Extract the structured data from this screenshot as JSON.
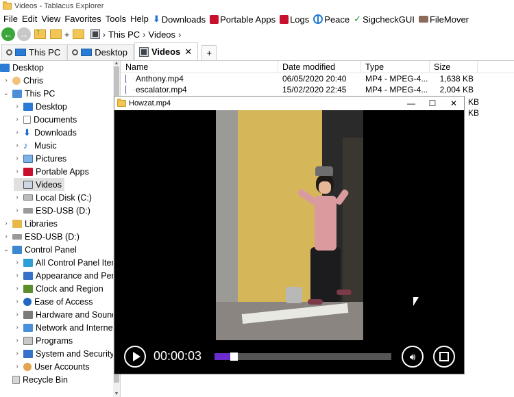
{
  "window": {
    "title": "Videos - Tablacus Explorer"
  },
  "menu": {
    "items": [
      "File",
      "Edit",
      "View",
      "Favorites",
      "Tools",
      "Help"
    ],
    "links": [
      {
        "label": "Downloads",
        "icon": "download-arrow-icon"
      },
      {
        "label": "Portable Apps",
        "icon": "portable-apps-icon"
      },
      {
        "label": "Logs",
        "icon": "logs-icon"
      },
      {
        "label": "Peace",
        "icon": "peace-icon"
      },
      {
        "label": "SigcheckGUI",
        "icon": "check-icon"
      },
      {
        "label": "FileMover",
        "icon": "truck-icon"
      }
    ]
  },
  "nav": {
    "up_label": "+",
    "breadcrumb": [
      "This PC",
      "Videos"
    ],
    "sep": "›"
  },
  "tabs": [
    {
      "label": "This PC",
      "icon": "pin-icon"
    },
    {
      "label": "Desktop",
      "icon": "desktop-icon"
    },
    {
      "label": "Videos",
      "icon": "videos-icon",
      "active": true,
      "close": "✕"
    }
  ],
  "tab_add": "+",
  "tree": [
    {
      "label": "Desktop",
      "icon": "desktop-icon",
      "level": 0,
      "chev": ""
    },
    {
      "label": "Chris",
      "icon": "user-icon",
      "level": 1,
      "chev": "›"
    },
    {
      "label": "This PC",
      "icon": "pc-icon",
      "level": 1,
      "chev": "⌄"
    },
    {
      "label": "Desktop",
      "icon": "desktop-icon",
      "level": 2,
      "chev": "›"
    },
    {
      "label": "Documents",
      "icon": "document-icon",
      "level": 2,
      "chev": "›"
    },
    {
      "label": "Downloads",
      "icon": "download-icon",
      "level": 2,
      "chev": "›"
    },
    {
      "label": "Music",
      "icon": "music-icon",
      "level": 2,
      "chev": "›"
    },
    {
      "label": "Pictures",
      "icon": "pictures-icon",
      "level": 2,
      "chev": "›"
    },
    {
      "label": "Portable Apps",
      "icon": "portable-apps-icon",
      "level": 2,
      "chev": "›"
    },
    {
      "label": "Videos",
      "icon": "videos-icon",
      "level": 2,
      "chev": "",
      "selected": true
    },
    {
      "label": "Local Disk (C:)",
      "icon": "disk-icon",
      "level": 2,
      "chev": "›"
    },
    {
      "label": "ESD-USB (D:)",
      "icon": "usb-icon",
      "level": 2,
      "chev": "›"
    },
    {
      "label": "Libraries",
      "icon": "library-icon",
      "level": 1,
      "chev": "›"
    },
    {
      "label": "ESD-USB (D:)",
      "icon": "usb-icon",
      "level": 1,
      "chev": "›"
    },
    {
      "label": "Control Panel",
      "icon": "control-panel-icon",
      "level": 1,
      "chev": "⌄"
    },
    {
      "label": "All Control Panel Item",
      "icon": "control-panel-items-icon",
      "level": 2,
      "chev": "›"
    },
    {
      "label": "Appearance and Pers",
      "icon": "appearance-icon",
      "level": 2,
      "chev": "›"
    },
    {
      "label": "Clock and Region",
      "icon": "clock-icon",
      "level": 2,
      "chev": "›"
    },
    {
      "label": "Ease of Access",
      "icon": "ease-of-access-icon",
      "level": 2,
      "chev": "›"
    },
    {
      "label": "Hardware and Sound",
      "icon": "hardware-icon",
      "level": 2,
      "chev": "›"
    },
    {
      "label": "Network and Internet",
      "icon": "network-icon",
      "level": 2,
      "chev": "›"
    },
    {
      "label": "Programs",
      "icon": "programs-icon",
      "level": 2,
      "chev": "›"
    },
    {
      "label": "System and Security",
      "icon": "security-icon",
      "level": 2,
      "chev": "›"
    },
    {
      "label": "User Accounts",
      "icon": "user-accounts-icon",
      "level": 2,
      "chev": "›"
    },
    {
      "label": "Recycle Bin",
      "icon": "recycle-bin-icon",
      "level": 1,
      "chev": ""
    }
  ],
  "list": {
    "columns": [
      "Name",
      "Date modified",
      "Type",
      "Size"
    ],
    "rows": [
      {
        "name": "Anthony.mp4",
        "date": "06/05/2020 20:40",
        "type": "MP4 - MPEG-4...",
        "size": "1,638 KB"
      },
      {
        "name": "escalator.mp4",
        "date": "15/02/2020 22:45",
        "type": "MP4 - MPEG-4...",
        "size": "2,004 KB"
      }
    ],
    "hidden_size_fragments": [
      "KB",
      "KB"
    ]
  },
  "player": {
    "title": "Howzat.mp4",
    "minimize": "—",
    "maximize": "☐",
    "close": "✕",
    "time": "00:00:03",
    "progress": 0.09,
    "volume_icon": "volume-icon",
    "fullscreen_icon": "fullscreen-icon",
    "accent": "#6a2ccc"
  }
}
